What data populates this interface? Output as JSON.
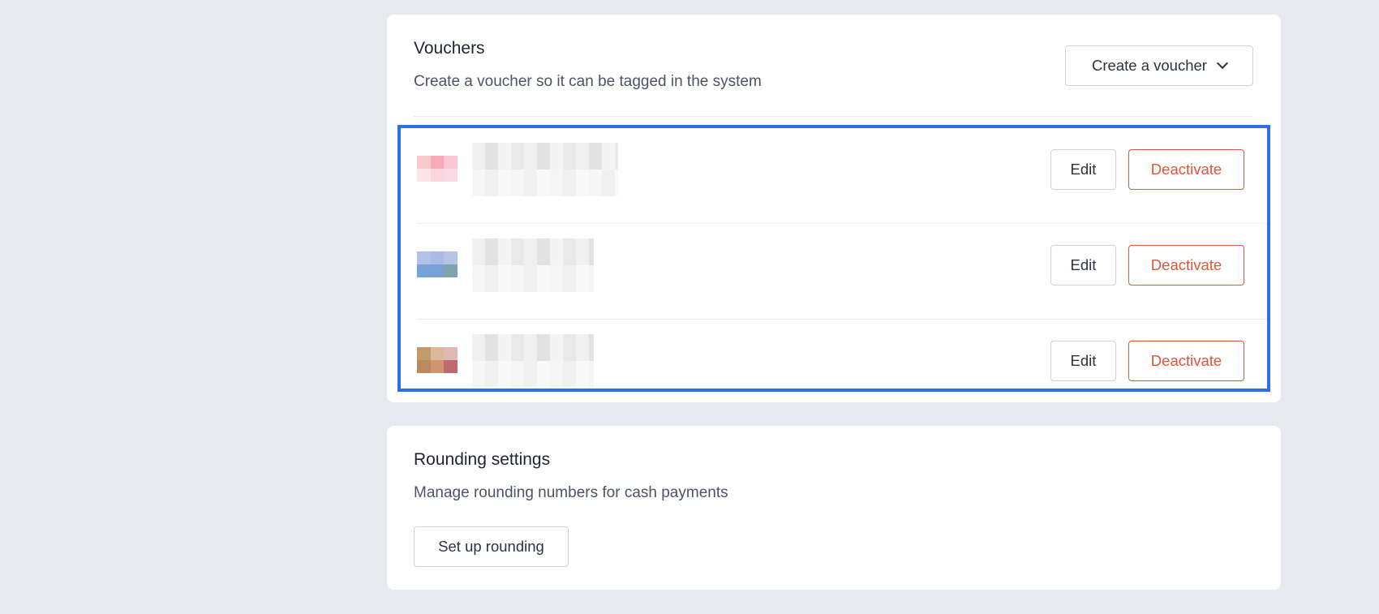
{
  "vouchers": {
    "title": "Vouchers",
    "subtitle": "Create a voucher so it can be tagged in the system",
    "create_button_label": "Create a voucher",
    "items": [
      {
        "edit_label": "Edit",
        "deactivate_label": "Deactivate",
        "thumb_colors": [
          "#f8c9cc",
          "#f7a9bb",
          "#fbc8d3",
          "#fde4e6",
          "#fbd7dd",
          "#fbd9e4"
        ]
      },
      {
        "edit_label": "Edit",
        "deactivate_label": "Deactivate",
        "thumb_colors": [
          "#b2c2e6",
          "#a9bbe6",
          "#b5c3e4",
          "#77a3da",
          "#76a2d8",
          "#7ea4b0"
        ]
      },
      {
        "edit_label": "Edit",
        "deactivate_label": "Deactivate",
        "thumb_colors": [
          "#c29b6d",
          "#d9b89b",
          "#e0b8b6",
          "#b98a5e",
          "#cf9571",
          "#bf6b6e"
        ]
      }
    ]
  },
  "rounding": {
    "title": "Rounding settings",
    "subtitle": "Manage rounding numbers for cash payments",
    "setup_button_label": "Set up rounding"
  },
  "colors": {
    "background": "#e6e9ee",
    "card": "#ffffff",
    "selection_border": "#2f6ee8",
    "danger": "#e0563a"
  }
}
